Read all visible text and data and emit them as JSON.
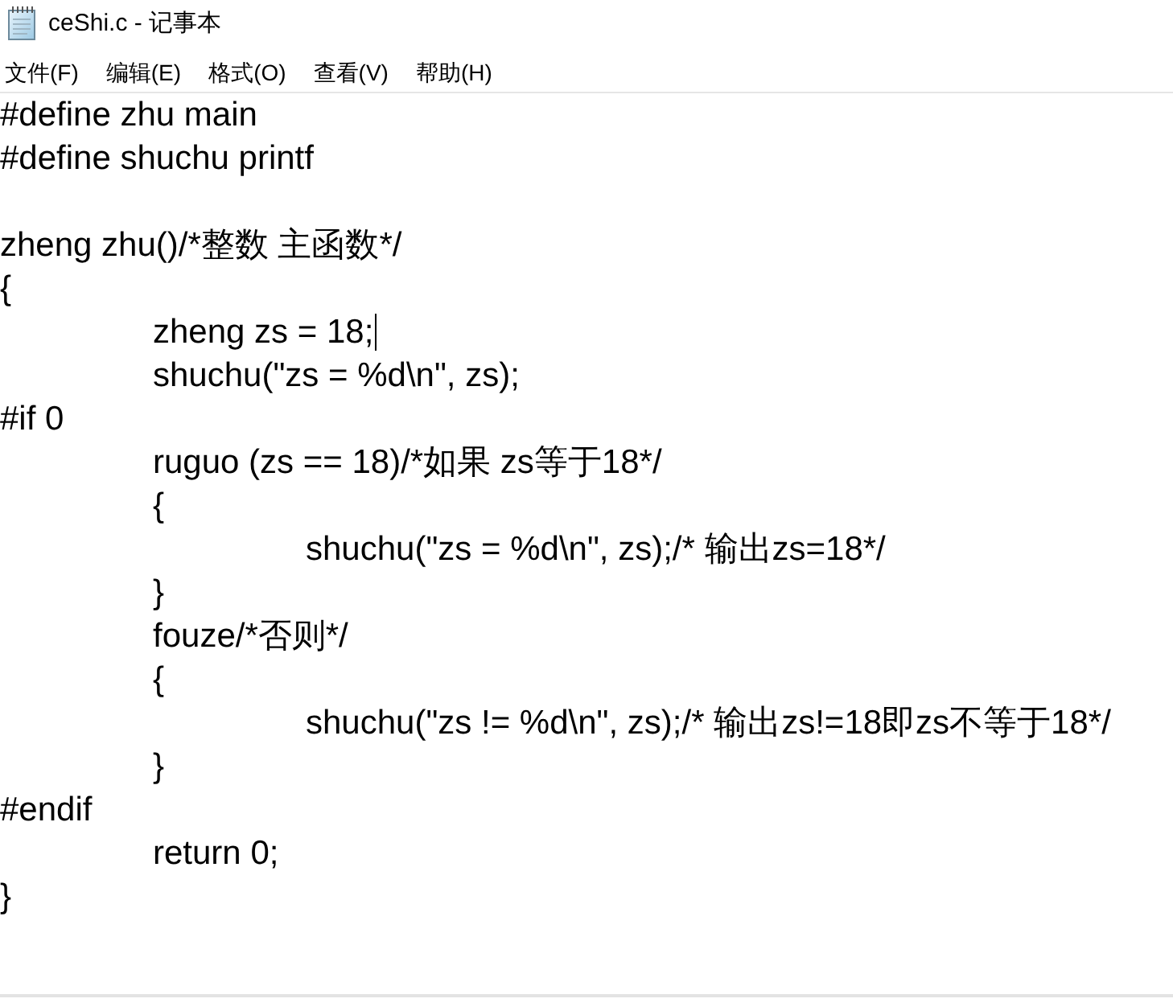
{
  "window": {
    "title": "ceShi.c - 记事本"
  },
  "menu": [
    "文件(F)",
    "编辑(E)",
    "格式(O)",
    "查看(V)",
    "帮助(H)"
  ],
  "editor": {
    "lines": [
      {
        "kind": "code",
        "text": "#define zhu main",
        "caret": false
      },
      {
        "kind": "code",
        "text": "#define shuchu printf",
        "caret": false
      },
      {
        "kind": "blank",
        "caret": false
      },
      {
        "kind": "code",
        "text": "zheng zhu()/*整数 主函数*/",
        "caret": false
      },
      {
        "kind": "code",
        "text": "{",
        "caret": false
      },
      {
        "kind": "code",
        "text": "\tzheng zs = 18;",
        "caret": true
      },
      {
        "kind": "code",
        "text": "\tshuchu(\"zs = %d\\n\", zs);",
        "caret": false
      },
      {
        "kind": "code",
        "text": "#if 0",
        "caret": false
      },
      {
        "kind": "code",
        "text": "\truguo (zs == 18)/*如果 zs等于18*/",
        "caret": false
      },
      {
        "kind": "code",
        "text": "\t{",
        "caret": false
      },
      {
        "kind": "code",
        "text": "\t\tshuchu(\"zs = %d\\n\", zs);/* 输出zs=18*/",
        "caret": false
      },
      {
        "kind": "code",
        "text": "\t}",
        "caret": false
      },
      {
        "kind": "code",
        "text": "\tfouze/*否则*/",
        "caret": false
      },
      {
        "kind": "code",
        "text": "\t{",
        "caret": false
      },
      {
        "kind": "code",
        "text": "\t\tshuchu(\"zs != %d\\n\", zs);/* 输出zs!=18即zs不等于18*/",
        "caret": false
      },
      {
        "kind": "code",
        "text": "\t}",
        "caret": false
      },
      {
        "kind": "code",
        "text": "#endif",
        "caret": false
      },
      {
        "kind": "code",
        "text": "\treturn 0;",
        "caret": false
      },
      {
        "kind": "code",
        "text": "}",
        "caret": false
      }
    ]
  }
}
